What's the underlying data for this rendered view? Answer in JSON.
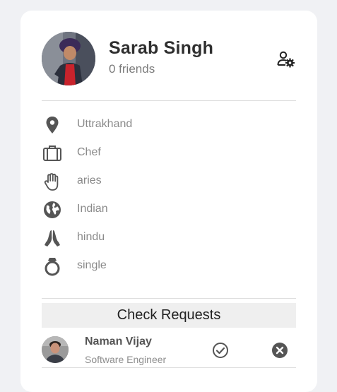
{
  "profile": {
    "name": "Sarab Singh",
    "friends_text": "0 friends",
    "settings_icon": "user-settings-icon"
  },
  "details": [
    {
      "icon": "location-pin-icon",
      "label": "Uttrakhand"
    },
    {
      "icon": "briefcase-icon",
      "label": "Chef"
    },
    {
      "icon": "hand-icon",
      "label": "aries"
    },
    {
      "icon": "globe-icon",
      "label": "Indian"
    },
    {
      "icon": "praying-hands-icon",
      "label": "hindu"
    },
    {
      "icon": "ring-icon",
      "label": "single"
    }
  ],
  "requests": {
    "button_label": "Check Requests",
    "items": [
      {
        "name": "Naman Vijay",
        "title": "Software Engineer"
      }
    ]
  },
  "colors": {
    "background": "#f0f1f4",
    "card": "#ffffff",
    "icon": "#555555",
    "muted_text": "#8a8a8a",
    "button_bg": "#efefef"
  }
}
